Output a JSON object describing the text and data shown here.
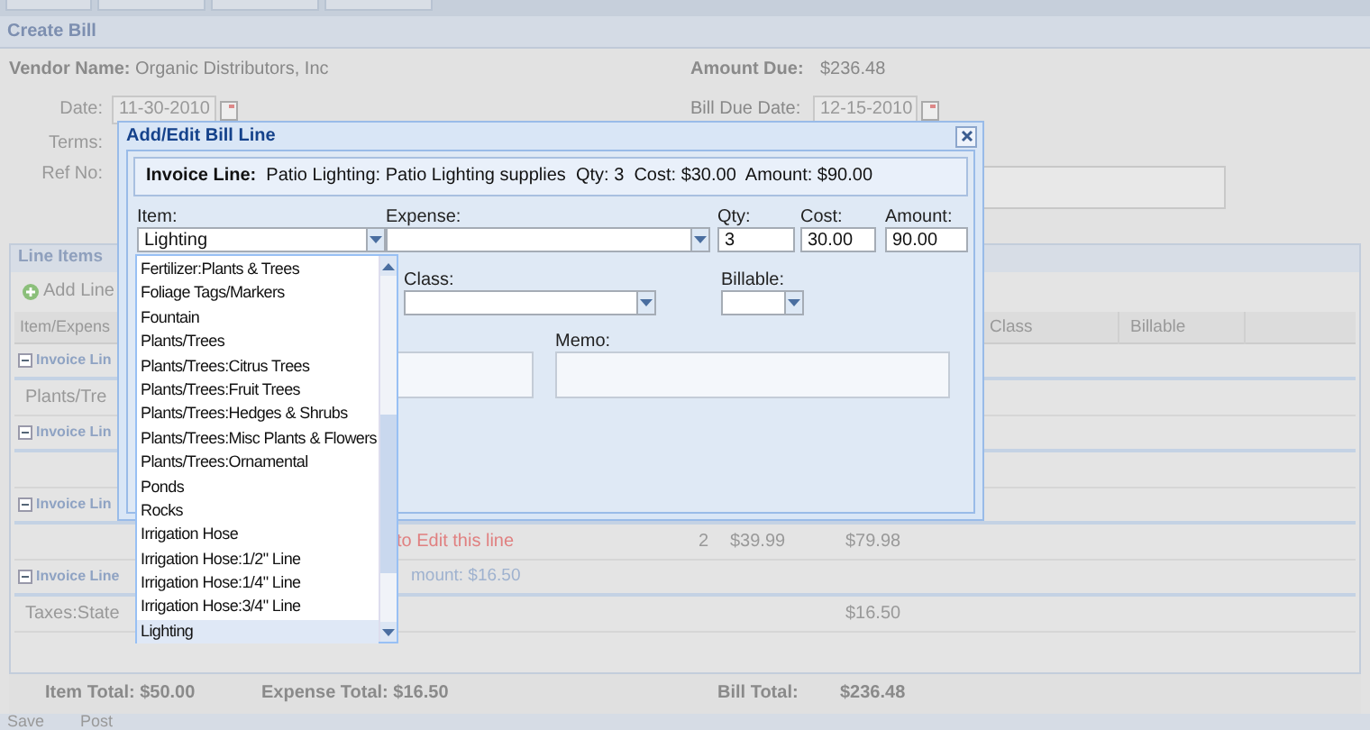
{
  "panel": {
    "title": "Create Bill"
  },
  "header": {
    "vendor_label": "Vendor Name:",
    "vendor": "Organic Distributors, Inc",
    "amount_due_label": "Amount Due:",
    "amount_due": "$236.48",
    "date_label": "Date:",
    "date": "11-30-2010",
    "due_label": "Bill Due Date:",
    "due_date": "12-15-2010",
    "terms_label": "Terms:",
    "ref_label": "Ref No:"
  },
  "line_items": {
    "title": "Line Items",
    "add_button": "Add Line",
    "columns": [
      {
        "label": "Item/Expens"
      },
      {},
      {},
      {},
      {
        "label": "Class"
      },
      {
        "label": "Billable"
      }
    ],
    "rows": [
      {
        "kind": "group",
        "label": "Invoice Lin",
        "expanded": true
      },
      {
        "kind": "line",
        "cells": [
          "Plants/Tre",
          "",
          "",
          "",
          "",
          ""
        ]
      },
      {
        "kind": "group",
        "label": "Invoice Lin",
        "expanded": true
      },
      {
        "kind": "line",
        "cells": [
          "",
          "",
          "",
          "",
          "",
          ""
        ]
      },
      {
        "kind": "group",
        "label": "Invoice Lin",
        "expanded": true
      },
      {
        "kind": "hint",
        "text": "to Edit this line",
        "cells": [
          "",
          "2",
          "$39.99",
          "$79.98",
          "",
          ""
        ]
      },
      {
        "kind": "group",
        "label": "Invoice Line",
        "summary": "mount: $16.50",
        "expanded": true
      },
      {
        "kind": "line",
        "cells": [
          "Taxes:State",
          "",
          "",
          "$16.50",
          "",
          ""
        ]
      }
    ]
  },
  "totals": {
    "item": "Item Total: $50.00",
    "expense": "Expense Total: $16.50",
    "bill_label": "Bill Total:",
    "bill": "$236.48"
  },
  "toolbar": [
    "Save",
    "Post"
  ],
  "dialog": {
    "title": "Add/Edit Bill Line",
    "summary_label": "Invoice Line:",
    "summary": "Patio Lighting: Patio Lighting supplies  Qty: 3  Cost: $30.00  Amount: $90.00",
    "item_label": "Item:",
    "item": "Lighting",
    "expense_label": "Expense:",
    "qty_label": "Qty:",
    "qty": "3",
    "cost_label": "Cost:",
    "cost": "30.00",
    "amount_label": "Amount:",
    "amount": "90.00",
    "class_label": "Class:",
    "billable_label": "Billable:",
    "memo_label": "Memo:"
  },
  "item_dropdown": {
    "expanded": true,
    "options": [
      {
        "label": "Fertilizer:Plants & Trees",
        "selected": false
      },
      {
        "label": "Foliage Tags/Markers",
        "selected": false
      },
      {
        "label": "Fountain",
        "selected": false
      },
      {
        "label": "Plants/Trees",
        "selected": false
      },
      {
        "label": "Plants/Trees:Citrus Trees",
        "selected": false
      },
      {
        "label": "Plants/Trees:Fruit Trees",
        "selected": false
      },
      {
        "label": "Plants/Trees:Hedges & Shrubs",
        "selected": false
      },
      {
        "label": "Plants/Trees:Misc Plants & Flowers",
        "selected": false
      },
      {
        "label": "Plants/Trees:Ornamental",
        "selected": false
      },
      {
        "label": "Ponds",
        "selected": false
      },
      {
        "label": "Rocks",
        "selected": false
      },
      {
        "label": "Irrigation Hose",
        "selected": false
      },
      {
        "label": "Irrigation Hose:1/2\" Line",
        "selected": false
      },
      {
        "label": "Irrigation Hose:1/4\" Line",
        "selected": false
      },
      {
        "label": "Irrigation Hose:3/4\" Line",
        "selected": false
      },
      {
        "label": "Lighting",
        "selected": true
      }
    ]
  }
}
